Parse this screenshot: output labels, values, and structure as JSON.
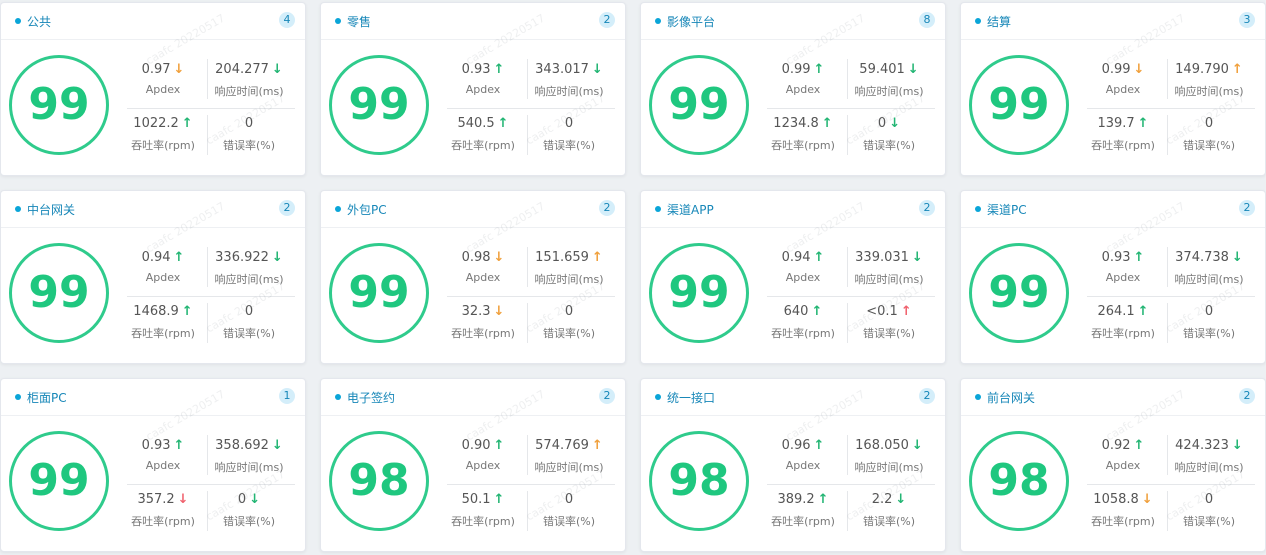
{
  "cards": [
    {
      "title": "公共",
      "count": "4",
      "score": "99",
      "apdex": {
        "value": "0.97",
        "arrow": "down-orange",
        "label": "Apdex"
      },
      "response": {
        "value": "204.277",
        "arrow": "down-green",
        "label": "响应时间(ms)"
      },
      "throughput": {
        "value": "1022.2",
        "arrow": "up-green",
        "label": "吞吐率(rpm)"
      },
      "error": {
        "value": "0",
        "arrow": "",
        "label": "错误率(%)"
      }
    },
    {
      "title": "零售",
      "count": "2",
      "score": "99",
      "apdex": {
        "value": "0.93",
        "arrow": "up-green",
        "label": "Apdex"
      },
      "response": {
        "value": "343.017",
        "arrow": "down-green",
        "label": "响应时间(ms)"
      },
      "throughput": {
        "value": "540.5",
        "arrow": "up-green",
        "label": "吞吐率(rpm)"
      },
      "error": {
        "value": "0",
        "arrow": "",
        "label": "错误率(%)"
      }
    },
    {
      "title": "影像平台",
      "count": "8",
      "score": "99",
      "apdex": {
        "value": "0.99",
        "arrow": "up-green",
        "label": "Apdex"
      },
      "response": {
        "value": "59.401",
        "arrow": "down-green",
        "label": "响应时间(ms)"
      },
      "throughput": {
        "value": "1234.8",
        "arrow": "up-green",
        "label": "吞吐率(rpm)"
      },
      "error": {
        "value": "0",
        "arrow": "down-green",
        "label": "错误率(%)"
      }
    },
    {
      "title": "结算",
      "count": "3",
      "score": "99",
      "apdex": {
        "value": "0.99",
        "arrow": "down-orange",
        "label": "Apdex"
      },
      "response": {
        "value": "149.790",
        "arrow": "up-orange",
        "label": "响应时间(ms)"
      },
      "throughput": {
        "value": "139.7",
        "arrow": "up-green",
        "label": "吞吐率(rpm)"
      },
      "error": {
        "value": "0",
        "arrow": "",
        "label": "错误率(%)"
      }
    },
    {
      "title": "中台网关",
      "count": "2",
      "score": "99",
      "apdex": {
        "value": "0.94",
        "arrow": "up-green",
        "label": "Apdex"
      },
      "response": {
        "value": "336.922",
        "arrow": "down-green",
        "label": "响应时间(ms)"
      },
      "throughput": {
        "value": "1468.9",
        "arrow": "up-green",
        "label": "吞吐率(rpm)"
      },
      "error": {
        "value": "0",
        "arrow": "",
        "label": "错误率(%)"
      }
    },
    {
      "title": "外包PC",
      "count": "2",
      "score": "99",
      "apdex": {
        "value": "0.98",
        "arrow": "down-orange",
        "label": "Apdex"
      },
      "response": {
        "value": "151.659",
        "arrow": "up-orange",
        "label": "响应时间(ms)"
      },
      "throughput": {
        "value": "32.3",
        "arrow": "down-orange",
        "label": "吞吐率(rpm)"
      },
      "error": {
        "value": "0",
        "arrow": "",
        "label": "错误率(%)"
      }
    },
    {
      "title": "渠道APP",
      "count": "2",
      "score": "99",
      "apdex": {
        "value": "0.94",
        "arrow": "up-green",
        "label": "Apdex"
      },
      "response": {
        "value": "339.031",
        "arrow": "down-green",
        "label": "响应时间(ms)"
      },
      "throughput": {
        "value": "640",
        "arrow": "up-green",
        "label": "吞吐率(rpm)"
      },
      "error": {
        "value": "<0.1",
        "arrow": "up-red",
        "label": "错误率(%)"
      }
    },
    {
      "title": "渠道PC",
      "count": "2",
      "score": "99",
      "apdex": {
        "value": "0.93",
        "arrow": "up-green",
        "label": "Apdex"
      },
      "response": {
        "value": "374.738",
        "arrow": "down-green",
        "label": "响应时间(ms)"
      },
      "throughput": {
        "value": "264.1",
        "arrow": "up-green",
        "label": "吞吐率(rpm)"
      },
      "error": {
        "value": "0",
        "arrow": "",
        "label": "错误率(%)"
      }
    },
    {
      "title": "柜面PC",
      "count": "1",
      "score": "99",
      "apdex": {
        "value": "0.93",
        "arrow": "up-green",
        "label": "Apdex"
      },
      "response": {
        "value": "358.692",
        "arrow": "down-green",
        "label": "响应时间(ms)"
      },
      "throughput": {
        "value": "357.2",
        "arrow": "down-red",
        "label": "吞吐率(rpm)"
      },
      "error": {
        "value": "0",
        "arrow": "down-green",
        "label": "错误率(%)"
      }
    },
    {
      "title": "电子签约",
      "count": "2",
      "score": "98",
      "apdex": {
        "value": "0.90",
        "arrow": "up-green",
        "label": "Apdex"
      },
      "response": {
        "value": "574.769",
        "arrow": "up-orange",
        "label": "响应时间(ms)"
      },
      "throughput": {
        "value": "50.1",
        "arrow": "up-green",
        "label": "吞吐率(rpm)"
      },
      "error": {
        "value": "0",
        "arrow": "",
        "label": "错误率(%)"
      }
    },
    {
      "title": "统一接口",
      "count": "2",
      "score": "98",
      "apdex": {
        "value": "0.96",
        "arrow": "up-green",
        "label": "Apdex"
      },
      "response": {
        "value": "168.050",
        "arrow": "down-green",
        "label": "响应时间(ms)"
      },
      "throughput": {
        "value": "389.2",
        "arrow": "up-green",
        "label": "吞吐率(rpm)"
      },
      "error": {
        "value": "2.2",
        "arrow": "down-green",
        "label": "错误率(%)"
      }
    },
    {
      "title": "前台网关",
      "count": "2",
      "score": "98",
      "apdex": {
        "value": "0.92",
        "arrow": "up-green",
        "label": "Apdex"
      },
      "response": {
        "value": "424.323",
        "arrow": "down-green",
        "label": "响应时间(ms)"
      },
      "throughput": {
        "value": "1058.8",
        "arrow": "down-orange",
        "label": "吞吐率(rpm)"
      },
      "error": {
        "value": "0",
        "arrow": "",
        "label": "错误率(%)"
      }
    }
  ],
  "watermark": "caafc 20220517",
  "colors": {
    "score": "#1fc77f",
    "ring": "#2fcb8c",
    "title": "#1787b8",
    "badge_bg": "#d4eefa",
    "up_green": "#22b573",
    "down_orange": "#f0a03c",
    "up_red": "#f0616d"
  }
}
